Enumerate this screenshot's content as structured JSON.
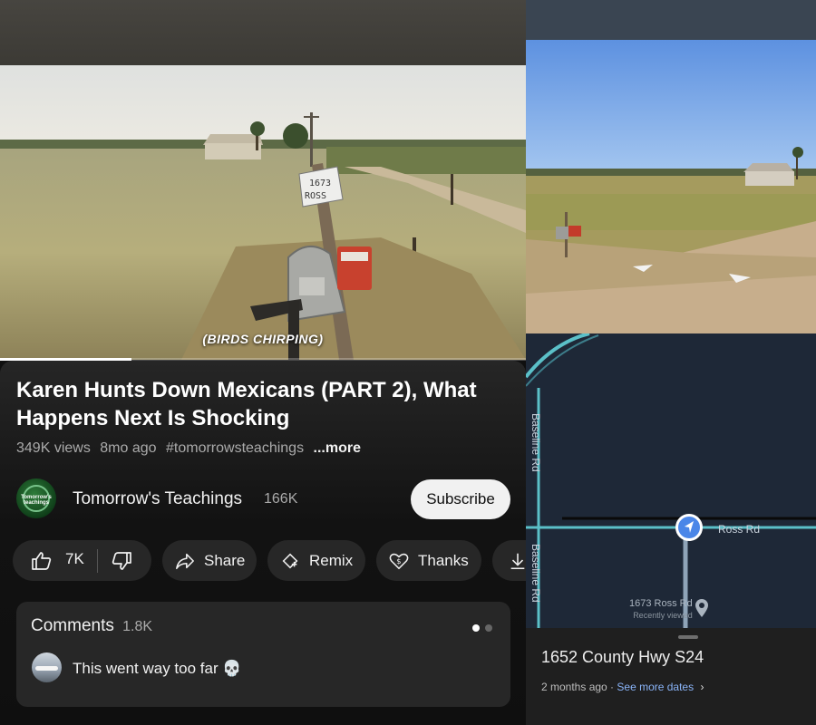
{
  "video": {
    "caption": "(BIRDS CHIRPING)",
    "sign_text_line1": "1673",
    "sign_text_line2": "ROSS",
    "progress_fraction": 0.25
  },
  "details": {
    "title": "Karen Hunts Down Mexicans (PART 2), What Happens Next Is Shocking",
    "views": "349K views",
    "age": "8mo ago",
    "hashtag": "#tomorrowsteachings",
    "more_label": "...more"
  },
  "channel": {
    "avatar_text": "Tomorrow's teachings",
    "name": "Tomorrow's Teachings",
    "subscribers": "166K",
    "subscribe_label": "Subscribe"
  },
  "actions": {
    "like_count": "7K",
    "share_label": "Share",
    "remix_label": "Remix",
    "thanks_label": "Thanks"
  },
  "comments": {
    "heading": "Comments",
    "count": "1.8K",
    "top_comment": "This went way too far 💀"
  },
  "map": {
    "road_vertical_1": "Baseline Rd",
    "road_vertical_2": "Baseline Rd",
    "road_horizontal": "Ross Rd",
    "pin_title": "1673 Ross Rd",
    "pin_subtitle": "Recently viewed",
    "address": "1652 County Hwy S24",
    "timestamp": "2 months ago ·",
    "see_more": "See more dates",
    "accent_color": "#4a86e8",
    "link_color": "#8ab4f8"
  }
}
